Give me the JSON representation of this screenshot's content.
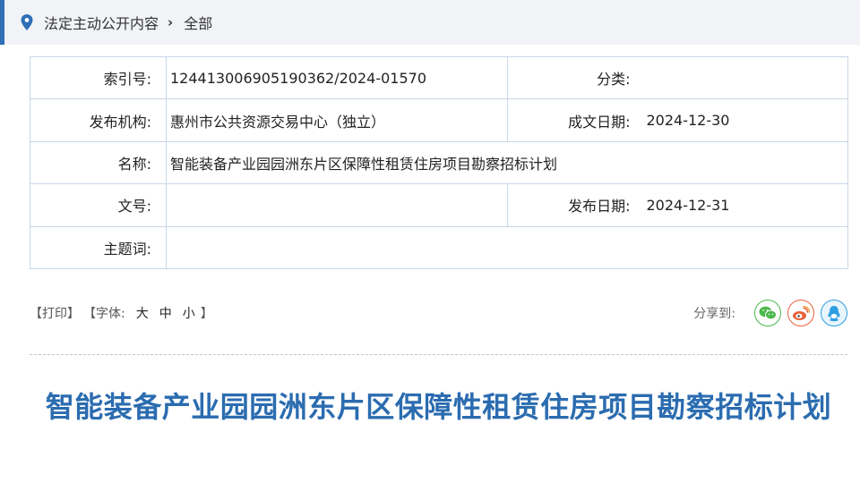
{
  "breadcrumb": {
    "section": "法定主动公开内容",
    "separator": "›",
    "current": "全部"
  },
  "meta": {
    "index_label": "索引号:",
    "index_value": "124413006905190362/2024-01570",
    "category_label": "分类:",
    "category_value": "",
    "publisher_label": "发布机构:",
    "publisher_value": "惠州市公共资源交易中心（独立）",
    "written_date_label": "成文日期:",
    "written_date_value": "2024-12-30",
    "name_label": "名称:",
    "name_value": "智能装备产业园园洲东片区保障性租赁住房项目勘察招标计划",
    "doc_no_label": "文号:",
    "doc_no_value": "",
    "publish_date_label": "发布日期:",
    "publish_date_value": "2024-12-31",
    "keywords_label": "主题词:",
    "keywords_value": ""
  },
  "toolbar": {
    "print_label": "【打印】",
    "font_label": "【字体:",
    "font_large": "大",
    "font_medium": "中",
    "font_small": "小",
    "font_close": "】",
    "share_label": "分享到:"
  },
  "share_icons": [
    "wechat-icon",
    "weibo-icon",
    "qq-icon"
  ],
  "article": {
    "title": "智能装备产业园园洲东片区保障性租赁住房项目勘察招标计划"
  },
  "colors": {
    "accent": "#2e6fb5",
    "title": "#2b6cb0",
    "table_border": "#c9d7e8",
    "wechat": "#4bb84c",
    "weibo": "#e8613a",
    "qq": "#2d9ee0"
  }
}
